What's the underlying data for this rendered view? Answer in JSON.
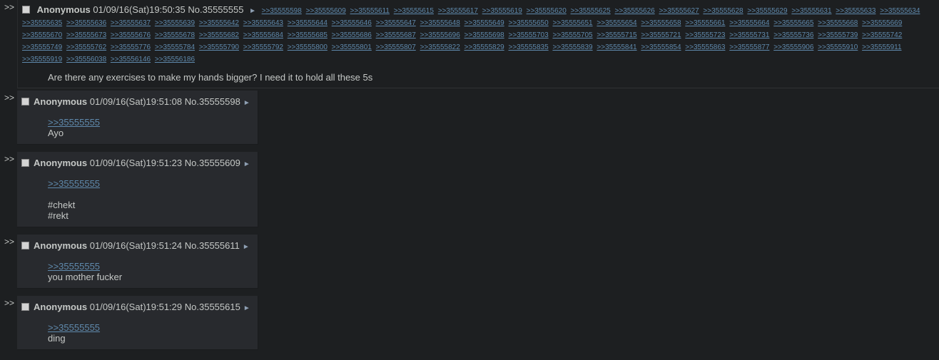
{
  "op": {
    "arrow": ">>",
    "name": "Anonymous",
    "date": "01/09/16(Sat)19:50:35",
    "number": "No.35555555",
    "tri": "►",
    "backlinks": [
      ">>35555598",
      ">>35555609",
      ">>35555611",
      ">>35555615",
      ">>35555617",
      ">>35555619",
      ">>35555620",
      ">>35555625",
      ">>35555626",
      ">>35555627",
      ">>35555628",
      ">>35555629",
      ">>35555631",
      ">>35555633",
      ">>35555634",
      ">>35555635",
      ">>35555636",
      ">>35555637",
      ">>35555639",
      ">>35555642",
      ">>35555643",
      ">>35555644",
      ">>35555646",
      ">>35555647",
      ">>35555648",
      ">>35555649",
      ">>35555650",
      ">>35555651",
      ">>35555654",
      ">>35555658",
      ">>35555661",
      ">>35555664",
      ">>35555665",
      ">>35555668",
      ">>35555669",
      ">>35555670",
      ">>35555673",
      ">>35555676",
      ">>35555678",
      ">>35555682",
      ">>35555684",
      ">>35555685",
      ">>35555686",
      ">>35555687",
      ">>35555696",
      ">>35555698",
      ">>35555703",
      ">>35555705",
      ">>35555715",
      ">>35555721",
      ">>35555723",
      ">>35555731",
      ">>35555736",
      ">>35555739",
      ">>35555742",
      ">>35555749",
      ">>35555762",
      ">>35555776",
      ">>35555784",
      ">>35555790",
      ">>35555792",
      ">>35555800",
      ">>35555801",
      ">>35555807",
      ">>35555822",
      ">>35555829",
      ">>35555835",
      ">>35555839",
      ">>35555841",
      ">>35555854",
      ">>35555863",
      ">>35555877",
      ">>35555906",
      ">>35555910",
      ">>35555911",
      ">>35555919",
      ">>35556038",
      ">>35556146",
      ">>35556186"
    ],
    "body": "Are there any exercises to make my hands bigger? I need it to hold all these 5s"
  },
  "replies": [
    {
      "arrow": ">>",
      "name": "Anonymous",
      "date": "01/09/16(Sat)19:51:08",
      "number": "No.35555598",
      "tri": "►",
      "quote": ">>35555555",
      "lines": [
        "Ayo"
      ]
    },
    {
      "arrow": ">>",
      "name": "Anonymous",
      "date": "01/09/16(Sat)19:51:23",
      "number": "No.35555609",
      "tri": "►",
      "quote": ">>35555555",
      "lines": [
        "#chekt",
        "#rekt"
      ]
    },
    {
      "arrow": ">>",
      "name": "Anonymous",
      "date": "01/09/16(Sat)19:51:24",
      "number": "No.35555611",
      "tri": "►",
      "quote": ">>35555555",
      "lines": [
        "you mother fucker"
      ]
    },
    {
      "arrow": ">>",
      "name": "Anonymous",
      "date": "01/09/16(Sat)19:51:29",
      "number": "No.35555615",
      "tri": "►",
      "quote": ">>35555555",
      "lines": [
        "ding"
      ]
    }
  ]
}
